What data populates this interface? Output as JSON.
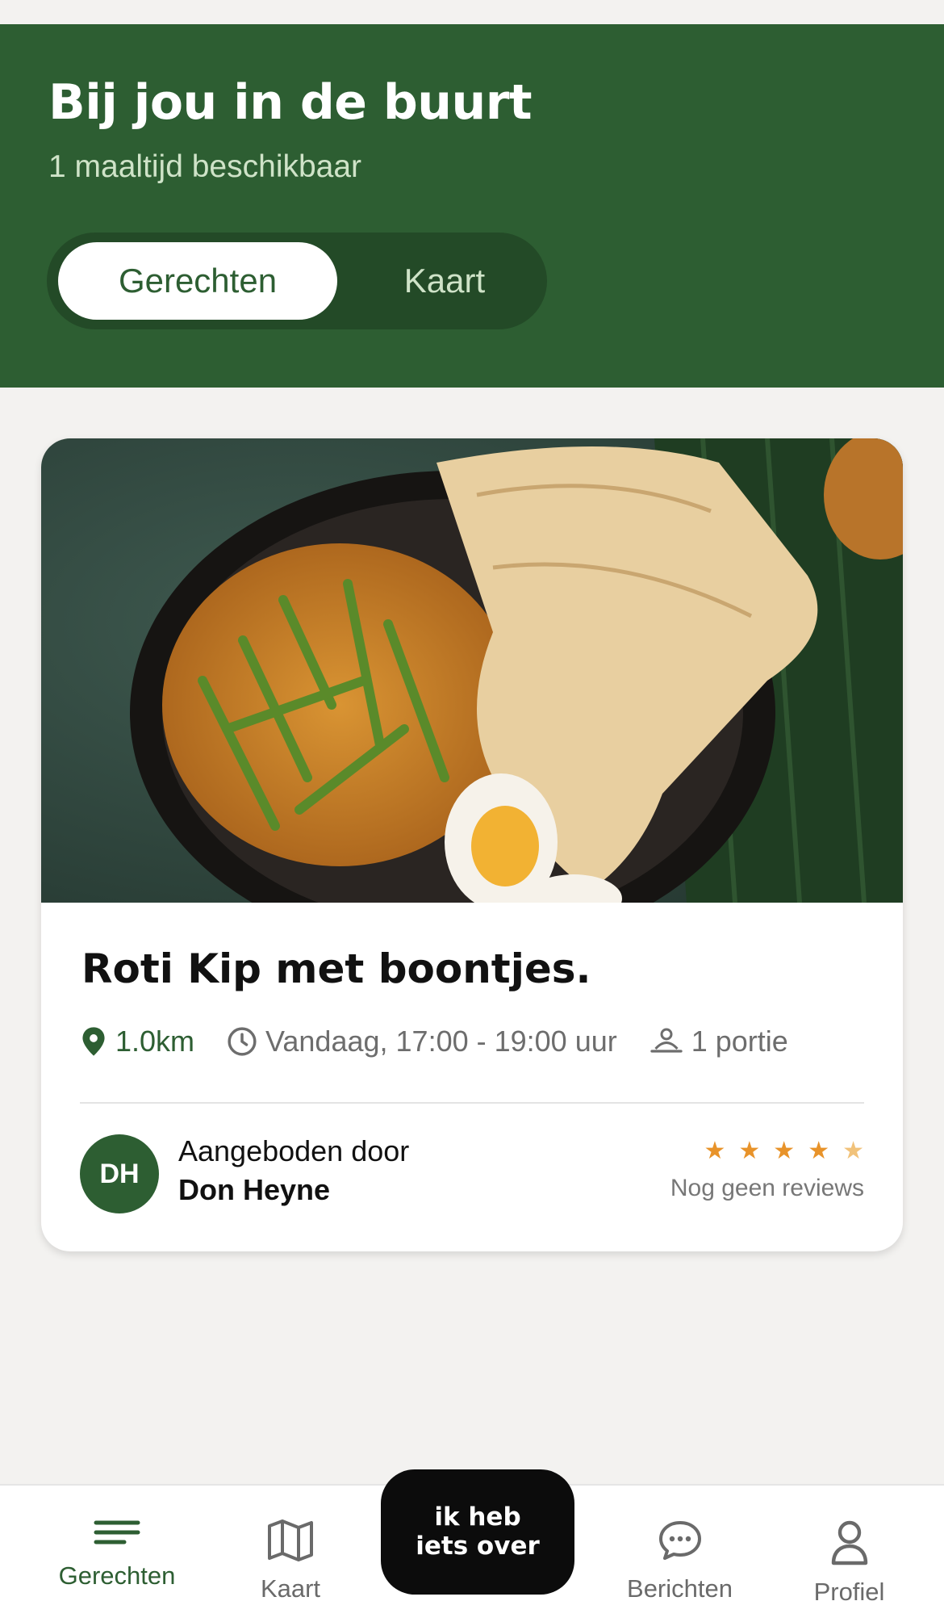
{
  "header": {
    "title": "Bij jou in de buurt",
    "subtitle": "1 maaltijd beschikbaar",
    "segments": [
      {
        "label": "Gerechten",
        "active": true
      },
      {
        "label": "Kaart",
        "active": false
      }
    ]
  },
  "listing": {
    "title": "Roti Kip met boontjes.",
    "distance": "1.0km",
    "time": "Vandaag, 17:00 - 19:00 uur",
    "portions": "1 portie",
    "offered_by_label": "Aangeboden door",
    "host_name": "Don Heyne",
    "host_initials": "DH",
    "rating_stars": 5,
    "reviews_text": "Nog geen reviews"
  },
  "tabbar": {
    "tabs": [
      {
        "label": "Gerechten",
        "icon": "list-icon",
        "active": true
      },
      {
        "label": "Kaart",
        "icon": "map-icon",
        "active": false
      },
      {
        "label": "Berichten",
        "icon": "chat-bubble-icon",
        "active": false
      },
      {
        "label": "Profiel",
        "icon": "user-icon",
        "active": false
      }
    ],
    "fab_label": "ik heb iets over"
  },
  "colors": {
    "brand_green": "#2d5e32",
    "segment_bg": "#234a27",
    "star": "#e8932a",
    "fab": "#0c0c0c"
  }
}
